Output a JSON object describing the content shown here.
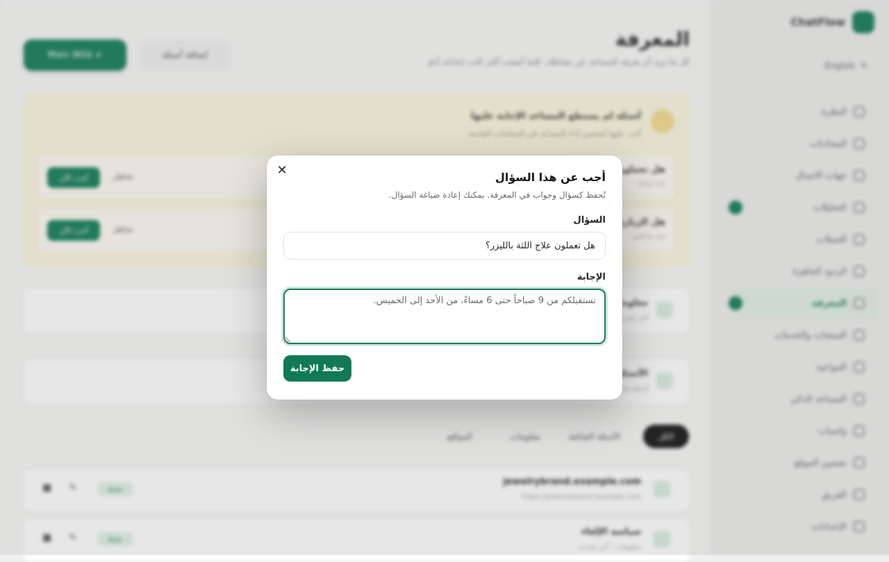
{
  "sidebar": {
    "brand": "ChatFlow",
    "language": "English",
    "items": [
      {
        "label": "النظرة"
      },
      {
        "label": "المحادثات"
      },
      {
        "label": "جهات الاتصال"
      },
      {
        "label": "التحليلات"
      },
      {
        "label": "الحملات"
      },
      {
        "label": "الردود الجاهزة"
      },
      {
        "label": "المعرفة"
      },
      {
        "label": "المنتجات والخدمات"
      },
      {
        "label": "المواعيد"
      },
      {
        "label": "المساعد الذكي"
      },
      {
        "label": "واتساب"
      },
      {
        "label": "تضمين الموقع"
      },
      {
        "label": "الفريق"
      },
      {
        "label": "الإعدادات"
      }
    ]
  },
  "header": {
    "title": "المعرفة",
    "subtitle": "كل ما تريد أن يعرفه المساعد عن نشاطك، كلما أضفت أكثر كانت إجاباته أدق",
    "add_button": "Main Wild +",
    "ghost_button": "إضافة أسئلة"
  },
  "unanswered": {
    "title": "أسئلة لم يستطع المساعد الإجابة عليها",
    "subtitle": "أجب عليها لتحسين أداء المساعد في المحادثات القادمة",
    "rows": [
      {
        "question": "هل تعملون...",
        "meta": "منذ ساعة",
        "answer_label": "أجب الآن",
        "ignore_label": "تجاهل"
      },
      {
        "question": "هل الزيارة...",
        "meta": "منذ ساعتين",
        "answer_label": "أجب الآن",
        "ignore_label": "تجاهل"
      }
    ]
  },
  "cards": [
    {
      "title": "معلومات",
      "meta": "آخر تحديث 2026/04/08 - نص المعلومات العامة"
    },
    {
      "title": "الأسئلة",
      "meta": "أسئلة شائعة"
    }
  ],
  "filters": [
    "الكل",
    "الأسئلة الشائعة",
    "معلومات",
    "المواقع"
  ],
  "sources": [
    {
      "title": "jewelrybrand.example.com",
      "meta": "https://jewelrybrand.example.com",
      "badge": "نشط"
    },
    {
      "title": "سياسة الإلغاء",
      "meta": "معلومات - آخر تحديث",
      "badge": "نشط"
    }
  ],
  "modal": {
    "title": "أجب عن هذا السؤال",
    "subtitle": "تُحفظ كسؤال وجواب في المعرفة. يمكنك إعادة صياغة السؤال.",
    "question_label": "السؤال",
    "question_value": "هل تعملون علاج اللثة بالليزر؟",
    "answer_label": "الإجابة",
    "answer_placeholder": "نستقبلكم من 9 صباحاً حتى 6 مساءً، من الأحد إلى الخميس.",
    "save_label": "حفظ الإجابة",
    "close_glyph": "✕"
  },
  "colors": {
    "accent": "#0f7a55",
    "warning_bg": "#fbf6df"
  }
}
